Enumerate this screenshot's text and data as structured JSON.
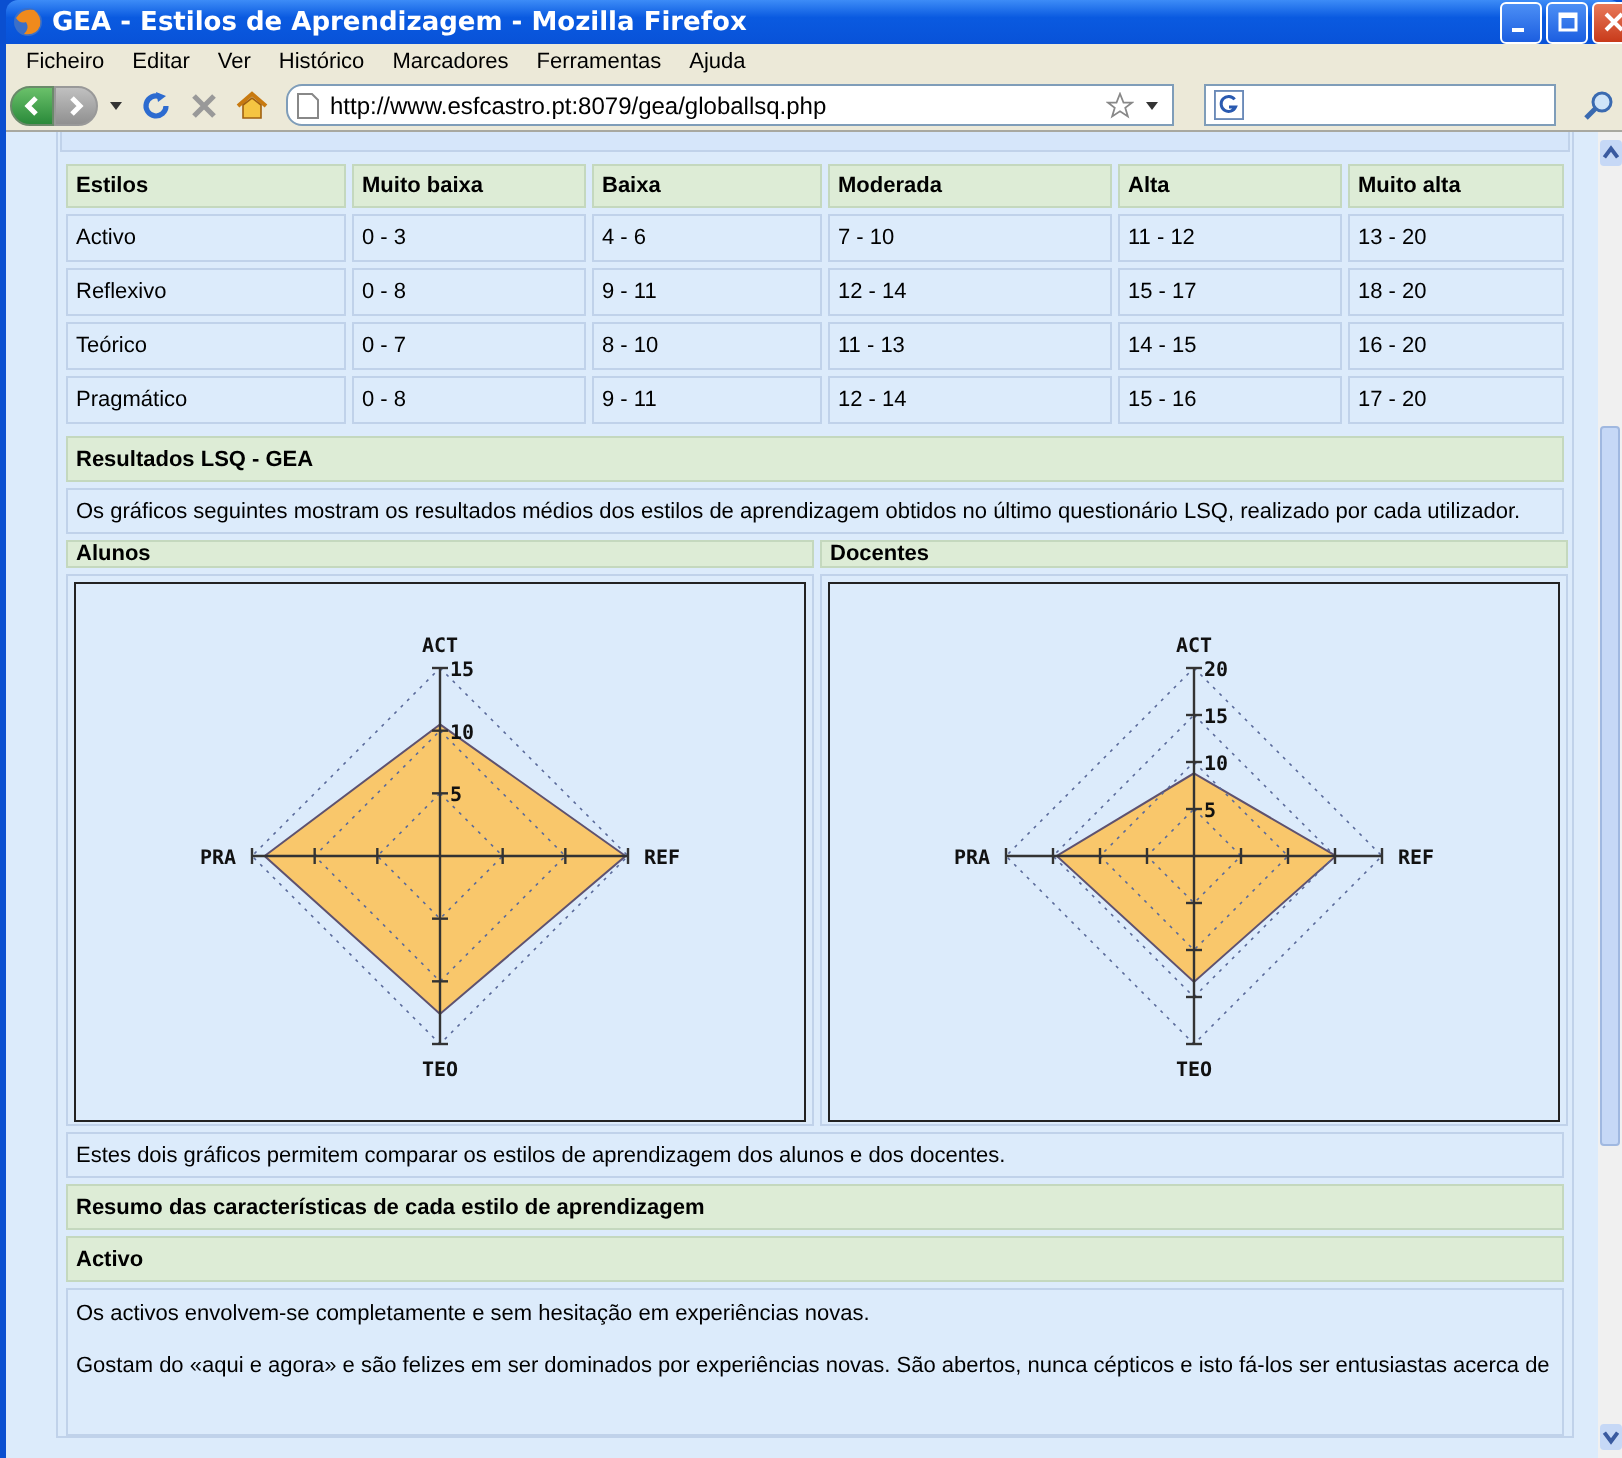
{
  "window": {
    "title": "GEA - Estilos de Aprendizagem - Mozilla Firefox",
    "menu": [
      "Ficheiro",
      "Editar",
      "Ver",
      "Histórico",
      "Marcadores",
      "Ferramentas",
      "Ajuda"
    ],
    "url": "http://www.esfcastro.pt:8079/gea/globallsq.php"
  },
  "score_table": {
    "columns": [
      "Estilos",
      "Muito baixa",
      "Baixa",
      "Moderada",
      "Alta",
      "Muito alta"
    ],
    "rows": [
      [
        "Activo",
        "0 - 3",
        "4 - 6",
        "7 - 10",
        "11 - 12",
        "13 - 20"
      ],
      [
        "Reflexivo",
        "0 - 8",
        "9 - 11",
        "12 - 14",
        "15 - 17",
        "18 - 20"
      ],
      [
        "Teórico",
        "0 - 7",
        "8 - 10",
        "11 - 13",
        "14 - 15",
        "16 - 20"
      ],
      [
        "Pragmático",
        "0 - 8",
        "9 - 11",
        "12 - 14",
        "15 - 16",
        "17 - 20"
      ]
    ]
  },
  "results_header": "Resultados LSQ - GEA",
  "results_text": "Os gráficos seguintes mostram os resultados médios dos estilos de aprendizagem obtidos no último questionário LSQ, realizado por cada utilizador.",
  "charts": [
    {
      "title": "Alunos",
      "axis_labels": [
        "ACT",
        "REF",
        "TEO",
        "PRA"
      ],
      "scale_labels": [
        "15",
        "10",
        "5"
      ]
    },
    {
      "title": "Docentes",
      "axis_labels": [
        "ACT",
        "REF",
        "TEO",
        "PRA"
      ],
      "scale_labels": [
        "20",
        "15",
        "10",
        "5"
      ]
    }
  ],
  "comparison_text": "Estes dois gráficos permitem comparar os estilos de aprendizagem dos alunos e dos docentes.",
  "summary_header": "Resumo das características de cada estilo de aprendizagem",
  "style_header": "Activo",
  "style_paragraphs": [
    "Os activos envolvem-se completamente e sem hesitação em experiências novas.",
    "Gostam do «aqui e agora» e são felizes em ser dominados por experiências novas. São abertos, nunca cépticos e isto fá-los ser entusiastas acerca de"
  ]
}
